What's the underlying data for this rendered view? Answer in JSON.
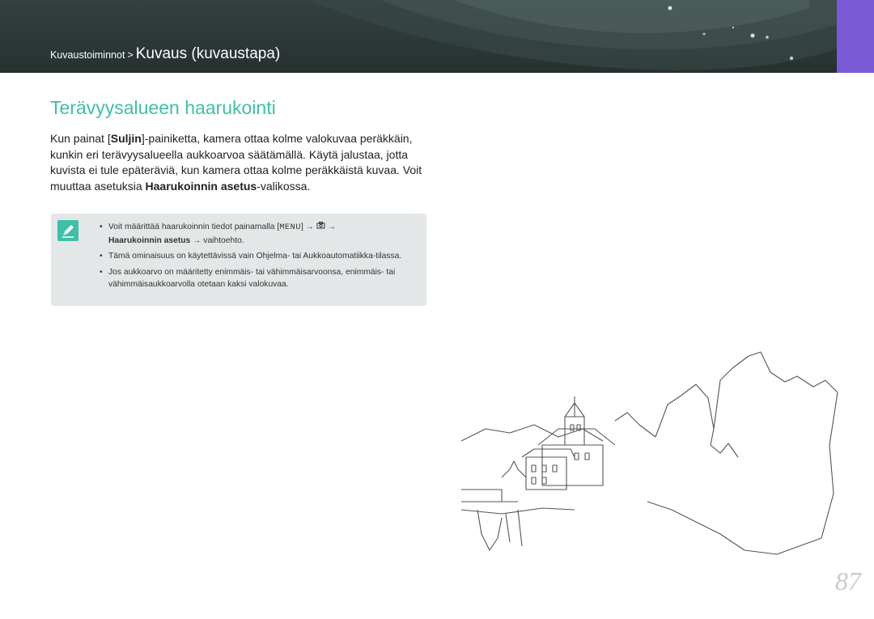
{
  "header": {
    "breadcrumb_parent": "Kuvaustoiminnot",
    "breadcrumb_separator": ">",
    "breadcrumb_current": "Kuvaus (kuvaustapa)",
    "accent_color": "#7b5ad6"
  },
  "section": {
    "title": "Terävyysalueen haarukointi",
    "title_color": "#3fbfa6",
    "body": {
      "p1": "Kun painat [",
      "shutter": "Suljin",
      "p2": "]-painiketta, kamera ottaa kolme valokuvaa peräkkäin, kunkin eri terävyysalueella aukkoarvoa säätämällä. Käytä jalustaa, jotta kuvista ei tule epäteräviä, kun kamera ottaa kolme peräkkäistä kuvaa. Voit muuttaa asetuksia ",
      "menu_name": "Haarukoinnin asetus",
      "p3": "-valikossa."
    }
  },
  "note": {
    "icon": "pencil-note-icon",
    "item1_text": "Voit määrittää haarukoinnin tiedot painamalla [",
    "item1_menu": "MENU",
    "item1_after": "] → ",
    "item1_camera_icon": "camera-icon",
    "item1_arrow": " →",
    "item1_setting": "Haarukoinnin asetus",
    "item1_end": " → vaihtoehto.",
    "item2": "Tämä ominaisuus on käytettävissä vain Ohjelma- tai Aukkoautomatiikka-tilassa.",
    "item3": "Jos aukkoarvo on määritetty enimmäis- tai vähimmäisarvoonsa, enimmäis- tai vähimmäisaukkoarvolla otetaan kaksi valokuvaa."
  },
  "page_number": "87"
}
